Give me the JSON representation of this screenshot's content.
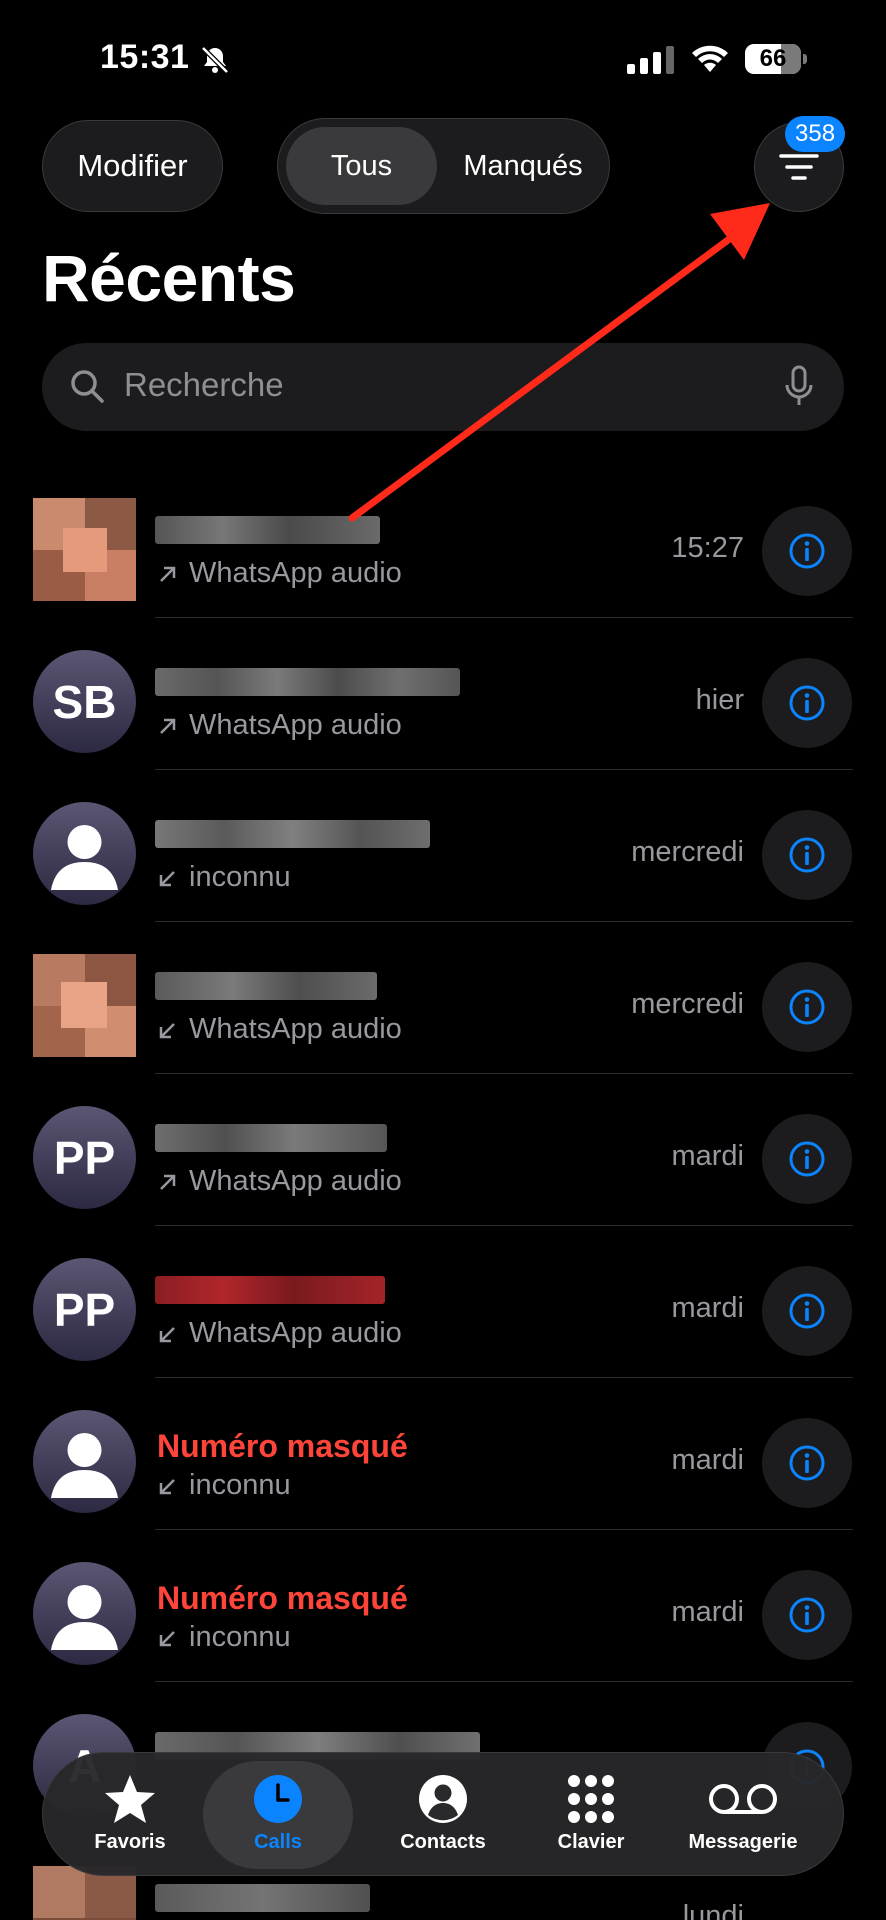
{
  "status_bar": {
    "time": "15:31",
    "battery": "66",
    "icons": [
      "bell-slash-icon",
      "cellular-signal-icon",
      "wifi-icon",
      "battery-icon"
    ]
  },
  "header": {
    "edit_label": "Modifier",
    "segments": [
      {
        "label": "Tous",
        "selected": true
      },
      {
        "label": "Manqués",
        "selected": false
      }
    ],
    "filter_badge": "358",
    "title": "Récents"
  },
  "search": {
    "placeholder": "Recherche"
  },
  "calls": [
    {
      "name": "",
      "name_blurred": true,
      "avatar": "photo",
      "direction": "outgoing",
      "type": "WhatsApp audio",
      "when": "15:27"
    },
    {
      "name": "",
      "name_blurred": true,
      "avatar": "initials",
      "initials": "SB",
      "direction": "outgoing",
      "type": "WhatsApp audio",
      "when": "hier"
    },
    {
      "name": "",
      "name_blurred": true,
      "avatar": "generic",
      "direction": "incoming",
      "type": "inconnu",
      "when": "mercredi"
    },
    {
      "name": "",
      "name_blurred": true,
      "avatar": "photo",
      "direction": "incoming",
      "type": "WhatsApp audio",
      "when": "mercredi"
    },
    {
      "name": "",
      "name_blurred": true,
      "avatar": "initials",
      "initials": "PP",
      "direction": "outgoing",
      "type": "WhatsApp audio",
      "when": "mardi"
    },
    {
      "name": "",
      "name_blurred": true,
      "missed": true,
      "avatar": "initials",
      "initials": "PP",
      "direction": "incoming",
      "type": "WhatsApp audio",
      "when": "mardi"
    },
    {
      "name": "Numéro masqué",
      "missed": true,
      "avatar": "generic",
      "direction": "incoming",
      "type": "inconnu",
      "when": "mardi"
    },
    {
      "name": "Numéro masqué",
      "missed": true,
      "avatar": "generic",
      "direction": "incoming",
      "type": "inconnu",
      "when": "mardi"
    },
    {
      "name": "",
      "name_blurred": true,
      "avatar": "initials",
      "initials": "A",
      "direction": "incoming",
      "type": "",
      "when": "",
      "partially_hidden": true
    },
    {
      "name": "",
      "name_blurred": true,
      "avatar": "photo",
      "direction": "incoming",
      "type": "",
      "when": "lundi",
      "partially_hidden": true
    }
  ],
  "tab_bar": {
    "tabs": [
      {
        "label": "Favoris",
        "icon": "star-icon",
        "active": false
      },
      {
        "label": "Calls",
        "icon": "clock-icon",
        "active": true
      },
      {
        "label": "Contacts",
        "icon": "person-circle-icon",
        "active": false
      },
      {
        "label": "Clavier",
        "icon": "keypad-icon",
        "active": false
      },
      {
        "label": "Messagerie",
        "icon": "voicemail-icon",
        "active": false
      }
    ]
  },
  "colors": {
    "background": "#000000",
    "accent": "#0a84ff",
    "missed": "#ff453a",
    "annotation_arrow": "#ff2a1a"
  }
}
